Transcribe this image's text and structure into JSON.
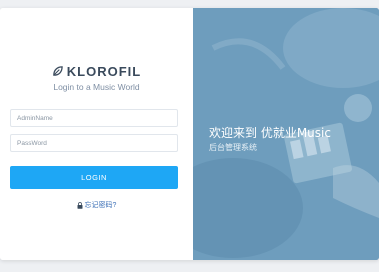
{
  "brand": {
    "name": "KLOROFIL",
    "tagline": "Login to a Music World",
    "icon": "leaf-icon"
  },
  "form": {
    "username_placeholder": "AdminName",
    "password_placeholder": "PassWord",
    "login_label": "LOGIN",
    "forgot_label": "忘记密码?"
  },
  "hero": {
    "title": "欢迎来到 优就业Music",
    "subtitle": "后台管理系统"
  },
  "colors": {
    "accent": "#1ea7f5",
    "panel": "#6b9bbb",
    "link": "#3b6fb6"
  }
}
